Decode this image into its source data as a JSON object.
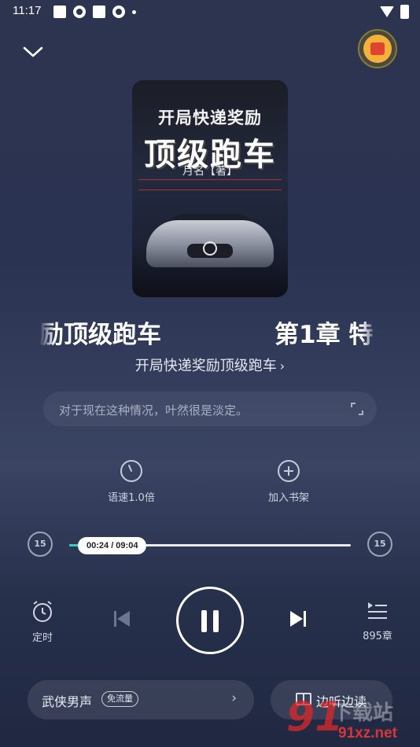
{
  "status_bar": {
    "time": "11:17"
  },
  "cover": {
    "title_line1": "开局快递奖励",
    "title_line2": "顶级跑车",
    "author": "月名【著】"
  },
  "now_playing": {
    "marquee_left": "励顶级跑车",
    "marquee_right": "第1章  特",
    "book_title": "开局快递奖励顶级跑车",
    "preview_text": "对于现在这种情况，叶然很是淡定。"
  },
  "tools": {
    "speed_label": "语速1.0倍",
    "add_shelf_label": "加入书架"
  },
  "player": {
    "rewind_seconds": "15",
    "forward_seconds": "15",
    "time_display": "00:24 / 09:04",
    "progress_fraction": 0.044,
    "timer_label": "定时",
    "chapter_count": "895章"
  },
  "bottom": {
    "voice_label": "武侠男声",
    "free_badge": "免流量",
    "read_label": "边听边读"
  },
  "watermark": {
    "digits": "91",
    "cn": "下载站",
    "url": "91xz.net"
  },
  "colors": {
    "accent": "#33d2b5",
    "background": "#2c3450"
  }
}
